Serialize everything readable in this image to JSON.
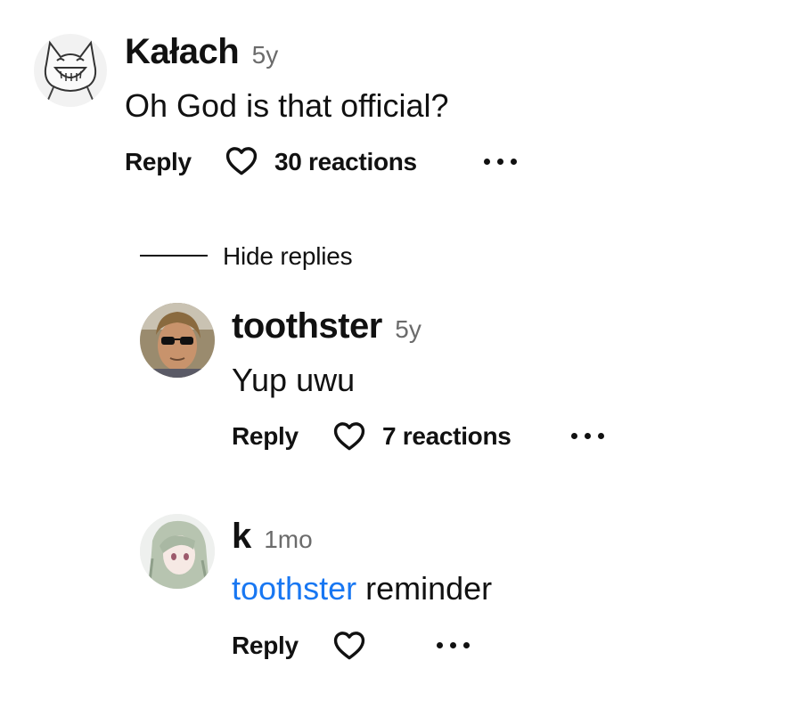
{
  "comments": [
    {
      "author": "Kałach",
      "age": "5y",
      "text": "Oh God is that official?",
      "reply_label": "Reply",
      "reactions": "30 reactions"
    },
    {
      "author": "toothster",
      "age": "5y",
      "text": "Yup uwu",
      "reply_label": "Reply",
      "reactions": "7 reactions"
    },
    {
      "author": "k",
      "age": "1mo",
      "mention": "toothster",
      "text": " reminder",
      "reply_label": "Reply"
    }
  ],
  "hide_replies_label": "Hide replies",
  "colors": {
    "mention": "#1877f2",
    "text": "#111111",
    "muted": "#6b6b6b"
  },
  "icons": {
    "reaction": "heart-outline-icon",
    "more": "more-horizontal-icon"
  }
}
